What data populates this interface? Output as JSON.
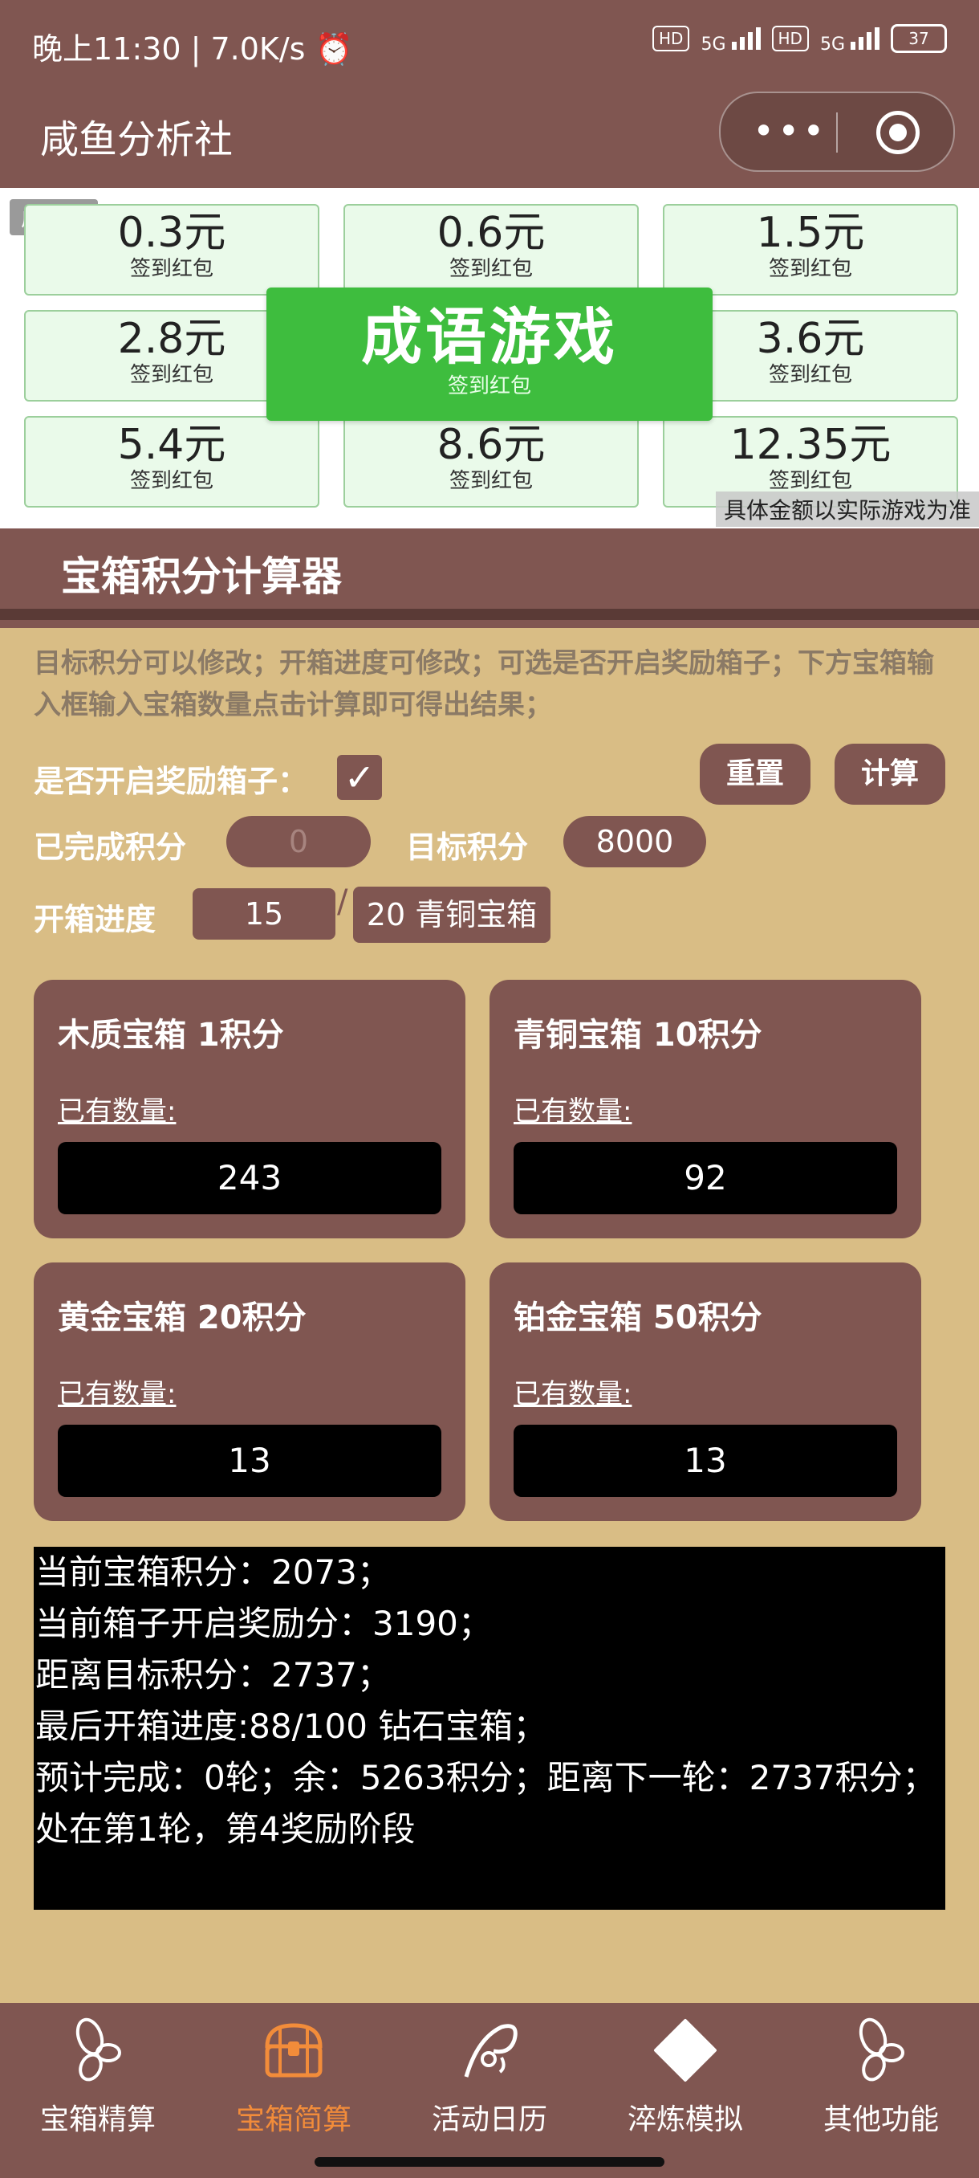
{
  "status_bar": {
    "left_text": "晚上11:30 | 7.0K/s",
    "hd": "HD",
    "net1": "5G",
    "net2": "5G",
    "battery": "37"
  },
  "app": {
    "title": "咸鱼分析社"
  },
  "ad": {
    "tag": "广告",
    "packets": [
      {
        "amount": "0.3元",
        "label": "签到红包"
      },
      {
        "amount": "0.6元",
        "label": "签到红包"
      },
      {
        "amount": "1.5元",
        "label": "签到红包"
      },
      {
        "amount": "2.8元",
        "label": "签到红包"
      },
      {
        "amount": "3.6元",
        "label": "签到红包"
      },
      {
        "amount": "5.4元",
        "label": "签到红包"
      },
      {
        "amount": "8.6元",
        "label": "签到红包"
      },
      {
        "amount": "12.35元",
        "label": "签到红包"
      }
    ],
    "banner_title": "成语游戏",
    "banner_subtitle": "签到红包",
    "note": "具体金额以实际游戏为准"
  },
  "calculator": {
    "title": "宝箱积分计算器",
    "description": "目标积分可以修改；开箱进度可修改；可选是否开启奖励箱子；下方宝箱输入框输入宝箱数量点击计算即可得出结果；",
    "reward_toggle_label": "是否开启奖励箱子：",
    "reward_toggle_mark": "✓",
    "reset_button": "重置",
    "calc_button": "计算",
    "completed_label": "已完成积分",
    "completed_value": "0",
    "target_label": "目标积分",
    "target_value": "8000",
    "progress_label": "开箱进度",
    "progress_value": "15",
    "progress_slash": "/",
    "progress_suffix": "20 青铜宝箱",
    "boxes": [
      {
        "name": "木质宝箱 1积分",
        "qty_label": "已有数量:",
        "qty": "243"
      },
      {
        "name": "青铜宝箱 10积分",
        "qty_label": "已有数量:",
        "qty": "92"
      },
      {
        "name": "黄金宝箱 20积分",
        "qty_label": "已有数量:",
        "qty": "13"
      },
      {
        "name": "铂金宝箱 50积分",
        "qty_label": "已有数量:",
        "qty": "13"
      }
    ],
    "results": [
      "当前宝箱积分：2073；",
      "当前箱子开启奖励分：3190；",
      "距离目标积分：2737；",
      "最后开箱进度:88/100 钻石宝箱；",
      "预计完成：0轮；余：5263积分；距离下一轮：2737积分；",
      "处在第1轮，第4奖励阶段"
    ]
  },
  "tabs": [
    {
      "label": "宝箱精算",
      "icon": "seed-icon",
      "active": false
    },
    {
      "label": "宝箱简算",
      "icon": "treasure-chest-icon",
      "active": true
    },
    {
      "label": "活动日历",
      "icon": "fishing-rod-icon",
      "active": false
    },
    {
      "label": "淬炼模拟",
      "icon": "diamond-icon",
      "active": false
    },
    {
      "label": "其他功能",
      "icon": "seed-icon",
      "active": false
    }
  ],
  "colors": {
    "brand": "#805651",
    "background": "#d9bd85",
    "active_tab": "#f28c3a",
    "ad_green": "#3ebd3e"
  }
}
